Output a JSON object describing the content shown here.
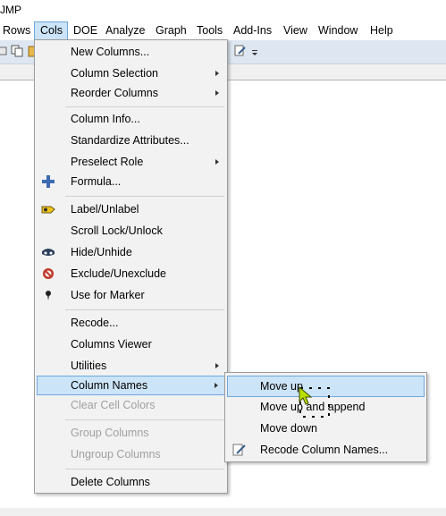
{
  "window": {
    "title": "JMP"
  },
  "menubar": {
    "items": [
      "Rows",
      "Cols",
      "DOE",
      "Analyze",
      "Graph",
      "Tools",
      "Add-Ins",
      "View",
      "Window",
      "Help"
    ],
    "active": "Cols"
  },
  "cols_menu": {
    "items": [
      {
        "label": "New Columns...",
        "submenu": false,
        "enabled": true,
        "icon": ""
      },
      {
        "label": "Column Selection",
        "submenu": true,
        "enabled": true,
        "icon": ""
      },
      {
        "label": "Reorder Columns",
        "submenu": true,
        "enabled": true,
        "icon": ""
      },
      {
        "label": "Column Info...",
        "submenu": false,
        "enabled": true,
        "icon": ""
      },
      {
        "label": "Standardize Attributes...",
        "submenu": false,
        "enabled": true,
        "icon": ""
      },
      {
        "label": "Preselect Role",
        "submenu": true,
        "enabled": true,
        "icon": ""
      },
      {
        "label": "Formula...",
        "submenu": false,
        "enabled": true,
        "icon": "plus-icon"
      },
      {
        "label": "Label/Unlabel",
        "submenu": false,
        "enabled": true,
        "icon": "label-tag-icon"
      },
      {
        "label": "Scroll Lock/Unlock",
        "submenu": false,
        "enabled": true,
        "icon": ""
      },
      {
        "label": "Hide/Unhide",
        "submenu": false,
        "enabled": true,
        "icon": "hidden-mask-icon"
      },
      {
        "label": "Exclude/Unexclude",
        "submenu": false,
        "enabled": true,
        "icon": "exclude-circle-icon"
      },
      {
        "label": "Use for Marker",
        "submenu": false,
        "enabled": true,
        "icon": "marker-pin-icon"
      },
      {
        "label": "Recode...",
        "submenu": false,
        "enabled": true,
        "icon": ""
      },
      {
        "label": "Columns Viewer",
        "submenu": false,
        "enabled": true,
        "icon": ""
      },
      {
        "label": "Utilities",
        "submenu": true,
        "enabled": true,
        "icon": ""
      },
      {
        "label": "Column Names",
        "submenu": true,
        "enabled": true,
        "icon": "",
        "highlighted": true
      },
      {
        "label": "Clear Cell Colors",
        "submenu": false,
        "enabled": false,
        "icon": ""
      },
      {
        "label": "Group Columns",
        "submenu": false,
        "enabled": false,
        "icon": ""
      },
      {
        "label": "Ungroup Columns",
        "submenu": false,
        "enabled": false,
        "icon": ""
      },
      {
        "label": "Delete Columns",
        "submenu": false,
        "enabled": true,
        "icon": ""
      }
    ]
  },
  "column_names_submenu": {
    "items": [
      {
        "label": "Move up",
        "highlighted": true,
        "icon": ""
      },
      {
        "label": "Move up and append",
        "icon": ""
      },
      {
        "label": "Move down",
        "icon": ""
      },
      {
        "label": "Recode Column Names...",
        "icon": "recode-pencil-icon"
      }
    ]
  },
  "colors": {
    "highlight_bg": "#cce4f7",
    "highlight_border": "#6fa8dc",
    "menu_bg": "#f2f2f2",
    "toolbar_bg": "#dde6f1",
    "disabled_text": "#a0a0a0"
  }
}
